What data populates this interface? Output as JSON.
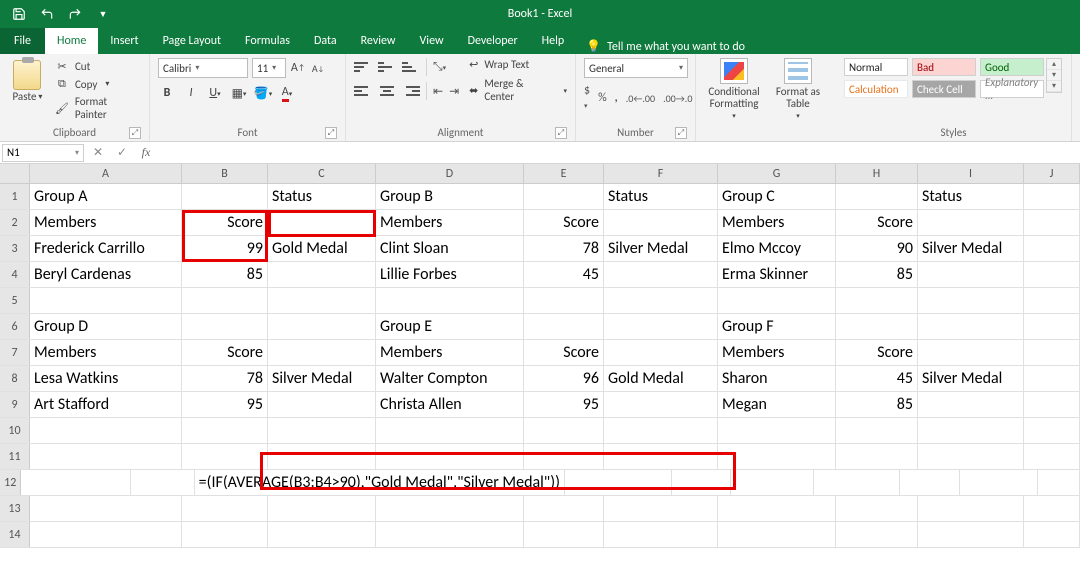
{
  "title": "Book1 - Excel",
  "qat": {
    "save": "💾"
  },
  "tabs": [
    "File",
    "Home",
    "Insert",
    "Page Layout",
    "Formulas",
    "Data",
    "Review",
    "View",
    "Developer",
    "Help"
  ],
  "tell_me": "Tell me what you want to do",
  "ribbon": {
    "clipboard": {
      "label": "Clipboard",
      "paste": "Paste",
      "cut": "Cut",
      "copy": "Copy",
      "fp": "Format Painter"
    },
    "font": {
      "label": "Font",
      "name": "Calibri",
      "size": "11"
    },
    "alignment": {
      "label": "Alignment",
      "wrap": "Wrap Text",
      "merge": "Merge & Center"
    },
    "number": {
      "label": "Number",
      "format": "General"
    },
    "cf": "Conditional Formatting",
    "ft": "Format as Table",
    "styles": {
      "label": "Styles",
      "normal": "Normal",
      "bad": "Bad",
      "good": "Good",
      "calc": "Calculation",
      "check": "Check Cell",
      "explan": "Explanatory ..."
    }
  },
  "name_box": "N1",
  "columns": [
    "A",
    "B",
    "C",
    "D",
    "E",
    "F",
    "G",
    "H",
    "I",
    "J"
  ],
  "sheet": {
    "r1": {
      "A": "Group A",
      "C": "Status",
      "D": "Group B",
      "F": "Status",
      "G": "Group C",
      "I": "Status"
    },
    "r2": {
      "A": "Members",
      "B": "Score",
      "D": "Members",
      "E": "Score",
      "G": "Members",
      "H": "Score"
    },
    "r3": {
      "A": "Frederick Carrillo",
      "B": "99",
      "C": "Gold Medal",
      "D": "Clint Sloan",
      "E": "78",
      "F": "Silver Medal",
      "G": "Elmo Mccoy",
      "H": "90",
      "I": "Silver Medal"
    },
    "r4": {
      "A": "Beryl Cardenas",
      "B": "85",
      "D": "Lillie Forbes",
      "E": "45",
      "G": "Erma Skinner",
      "H": "85"
    },
    "r6": {
      "A": "Group D",
      "D": "Group E",
      "G": "Group F"
    },
    "r7": {
      "A": "Members",
      "B": "Score",
      "D": "Members",
      "E": "Score",
      "G": "Members",
      "H": "Score"
    },
    "r8": {
      "A": "Lesa Watkins",
      "B": "78",
      "C": "Silver Medal",
      "D": "Walter Compton",
      "E": "96",
      "F": "Gold Medal",
      "G": "Sharon",
      "H": "45",
      "I": "Silver Medal"
    },
    "r9": {
      "A": "Art Stafford",
      "B": "95",
      "D": "Christa Allen",
      "E": "95",
      "G": "Megan",
      "H": "85"
    },
    "r12": {
      "C": "=(IF(AVERAGE(B3:B4>90),\"Gold Medal\",\"Silver Medal\"))"
    }
  }
}
